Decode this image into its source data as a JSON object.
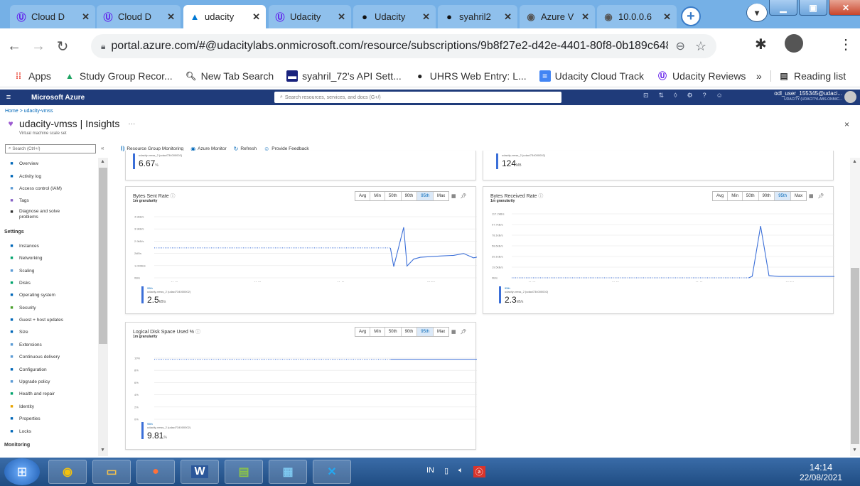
{
  "browser": {
    "tabs": [
      {
        "icon": "udacity-icon",
        "title": "Cloud D",
        "active": false
      },
      {
        "icon": "udacity-icon",
        "title": "Cloud D",
        "active": false
      },
      {
        "icon": "azure-icon",
        "title": "udacity",
        "active": true
      },
      {
        "icon": "udacity-icon",
        "title": "Udacity",
        "active": false
      },
      {
        "icon": "github-icon",
        "title": "Udacity",
        "active": false
      },
      {
        "icon": "github-icon",
        "title": "syahril2",
        "active": false
      },
      {
        "icon": "globe-icon",
        "title": "Azure V",
        "active": false
      },
      {
        "icon": "globe-icon",
        "title": "10.0.0.6",
        "active": false
      }
    ],
    "url": "portal.azure.com/#@udacitylabs.onmicrosoft.com/resource/subscriptions/9b8f27e2-d42e-4401-80f8-0b189c648389/resour...",
    "bookmarks": [
      {
        "icon": "apps-icon",
        "label": "Apps"
      },
      {
        "icon": "drive-icon",
        "label": "Study Group Recor..."
      },
      {
        "icon": "search-icon",
        "label": "New Tab Search"
      },
      {
        "icon": "api-icon",
        "label": "syahril_72's API Sett..."
      },
      {
        "icon": "uhrs-icon",
        "label": "UHRS Web Entry: L..."
      },
      {
        "icon": "doc-icon",
        "label": "Udacity Cloud Track"
      },
      {
        "icon": "udacity-icon",
        "label": "Udacity Reviews"
      }
    ],
    "reading_list": "Reading list",
    "overflow": "»"
  },
  "azure": {
    "brand": "Microsoft Azure",
    "search_placeholder": "Search resources, services, and docs (G+/)",
    "user": "odl_user_155345@udaci...",
    "org": "UDACITY (UDACITYLABS.ONMIC..."
  },
  "page": {
    "breadcrumb": "Home > udacity-vmss",
    "title": "udacity-vmss | Insights",
    "more": "···",
    "subtitle": "Virtual machine scale set",
    "close": "×"
  },
  "leftnav": {
    "search_placeholder": "Search (Ctrl+/)",
    "collapse": "«",
    "items": [
      {
        "type": "item",
        "icon": "overview-icon",
        "label": "Overview",
        "color": "#0067b8"
      },
      {
        "type": "item",
        "icon": "activity-log-icon",
        "label": "Activity log",
        "color": "#0067b8"
      },
      {
        "type": "item",
        "icon": "iam-icon",
        "label": "Access control (IAM)",
        "color": "#5b9bd5"
      },
      {
        "type": "item",
        "icon": "tag-icon",
        "label": "Tags",
        "color": "#8661c5"
      },
      {
        "type": "item",
        "icon": "wrench-icon",
        "label": "Diagnose and solve problems",
        "color": "#333"
      },
      {
        "type": "section",
        "label": "Settings"
      },
      {
        "type": "item",
        "icon": "instances-icon",
        "label": "Instances",
        "color": "#0067b8"
      },
      {
        "type": "item",
        "icon": "networking-icon",
        "label": "Networking",
        "color": "#00a36c"
      },
      {
        "type": "item",
        "icon": "scaling-icon",
        "label": "Scaling",
        "color": "#5b9bd5"
      },
      {
        "type": "item",
        "icon": "disks-icon",
        "label": "Disks",
        "color": "#00a36c"
      },
      {
        "type": "item",
        "icon": "os-icon",
        "label": "Operating system",
        "color": "#0067b8"
      },
      {
        "type": "item",
        "icon": "security-icon",
        "label": "Security",
        "color": "#4aa02c"
      },
      {
        "type": "item",
        "icon": "updates-icon",
        "label": "Guest + host updates",
        "color": "#0067b8"
      },
      {
        "type": "item",
        "icon": "size-icon",
        "label": "Size",
        "color": "#0067b8"
      },
      {
        "type": "item",
        "icon": "extensions-icon",
        "label": "Extensions",
        "color": "#5b9bd5"
      },
      {
        "type": "item",
        "icon": "delivery-icon",
        "label": "Continuous delivery",
        "color": "#5b9bd5"
      },
      {
        "type": "item",
        "icon": "configuration-icon",
        "label": "Configuration",
        "color": "#0067b8"
      },
      {
        "type": "item",
        "icon": "upgrade-icon",
        "label": "Upgrade policy",
        "color": "#5b9bd5"
      },
      {
        "type": "item",
        "icon": "health-icon",
        "label": "Health and repair",
        "color": "#00a36c"
      },
      {
        "type": "item",
        "icon": "identity-icon",
        "label": "Identity",
        "color": "#e8a400"
      },
      {
        "type": "item",
        "icon": "properties-icon",
        "label": "Properties",
        "color": "#0067b8"
      },
      {
        "type": "item",
        "icon": "lock-icon",
        "label": "Locks",
        "color": "#0067b8"
      },
      {
        "type": "section",
        "label": "Monitoring"
      }
    ]
  },
  "toolbar": {
    "items": [
      {
        "icon": "resource-group-icon",
        "label": "Resource Group Monitoring"
      },
      {
        "icon": "azure-monitor-icon",
        "label": "Azure Monitor"
      },
      {
        "icon": "refresh-icon",
        "label": "Refresh"
      },
      {
        "icon": "feedback-icon",
        "label": "Provide Feedback"
      }
    ]
  },
  "aggregations": [
    "Avg",
    "Min",
    "50th",
    "90th",
    "95th",
    "Max"
  ],
  "aggregation_selected": "95th",
  "cards": {
    "top_left": {
      "legend_line1": "udacity-vmss_2 (udaci734000002)",
      "value": "6.67",
      "unit": "%"
    },
    "top_right": {
      "legend_line1": "udacity-vmss_2 (udaci734000002)",
      "value": "124",
      "unit": "MB"
    },
    "bytes_sent": {
      "title": "Bytes Sent Rate",
      "info": "ⓘ",
      "granularity": "1m granularity",
      "legend_line1": "95th",
      "legend_line2": "udacity-vmss_2 (udaci734000002)",
      "value": "2.5",
      "unit": "kB/s"
    },
    "bytes_received": {
      "title": "Bytes Received Rate",
      "info": "ⓘ",
      "granularity": "1m granularity",
      "legend_line1": "95th",
      "legend_line2": "udacity-vmss_2 (udaci734000002)",
      "value": "2.3",
      "unit": "kB/s"
    },
    "disk": {
      "title": "Logical Disk Space Used %",
      "info": "ⓘ",
      "granularity": "1m granularity",
      "legend_line1": "95th",
      "legend_line2": "udacity-vmss_2 (udaci734000002)",
      "value": "9.81",
      "unit": "%"
    }
  },
  "chart_data": [
    {
      "type": "line",
      "title": "Bytes Sent Rate",
      "subtitle": "1m granularity",
      "x_ticks": [
        "01:15",
        "01:30",
        "01:45",
        "02 PM"
      ],
      "y_ticks": [
        "4.9kB/s",
        "3.9kB/s",
        "2.9kB/s",
        "2kB/s",
        "1,000B/s",
        "0B/s"
      ],
      "ylim": [
        0,
        4900
      ],
      "series": [
        {
          "style": "dotted",
          "x": [
            0,
            0.71
          ],
          "y": [
            2400,
            2400
          ]
        },
        {
          "style": "solid",
          "x": [
            0.71,
            0.72,
            0.75,
            0.76,
            0.78,
            0.8,
            0.83,
            0.86,
            0.9,
            0.93,
            0.96,
            1.0
          ],
          "y": [
            2400,
            900,
            4050,
            950,
            1500,
            1650,
            1700,
            1750,
            1800,
            1950,
            1600,
            1850
          ]
        }
      ]
    },
    {
      "type": "line",
      "title": "Bytes Received Rate",
      "subtitle": "1m granularity",
      "x_ticks": [
        "01:15",
        "01:30",
        "01:45",
        "02 PM"
      ],
      "y_ticks": [
        "117.2kB/s",
        "97.7kB/s",
        "78.1kB/s",
        "58.6kB/s",
        "39.1kB/s",
        "19.5kB/s",
        "0B/s"
      ],
      "ylim": [
        0,
        117200
      ],
      "series": [
        {
          "style": "dotted",
          "x": [
            0,
            0.71
          ],
          "y": [
            0,
            0
          ]
        },
        {
          "style": "solid",
          "x": [
            0.71,
            0.72,
            0.745,
            0.77,
            0.8,
            0.85,
            0.9,
            0.95,
            1.0
          ],
          "y": [
            0,
            3000,
            95000,
            4000,
            2500,
            2500,
            2500,
            2500,
            2500
          ]
        }
      ]
    },
    {
      "type": "line",
      "title": "Logical Disk Space Used %",
      "subtitle": "1m granularity",
      "x_ticks": [
        "01:15",
        "01:30",
        "01:45",
        "02 PM"
      ],
      "y_ticks": [
        "10%",
        "8%",
        "6%",
        "4%",
        "2%",
        "0%"
      ],
      "ylim": [
        0,
        10
      ],
      "series": [
        {
          "style": "dotted",
          "x": [
            0,
            0.71
          ],
          "y": [
            9.81,
            9.81
          ]
        },
        {
          "style": "solid",
          "x": [
            0.71,
            1.0
          ],
          "y": [
            9.81,
            9.81
          ]
        }
      ]
    }
  ],
  "taskbar": {
    "apps": [
      "windows-explorer",
      "chrome",
      "folder",
      "firefox",
      "word",
      "system",
      "control-panel",
      "vscode"
    ],
    "tray_lang": "IN",
    "time": "14:14",
    "date": "22/08/2021"
  }
}
